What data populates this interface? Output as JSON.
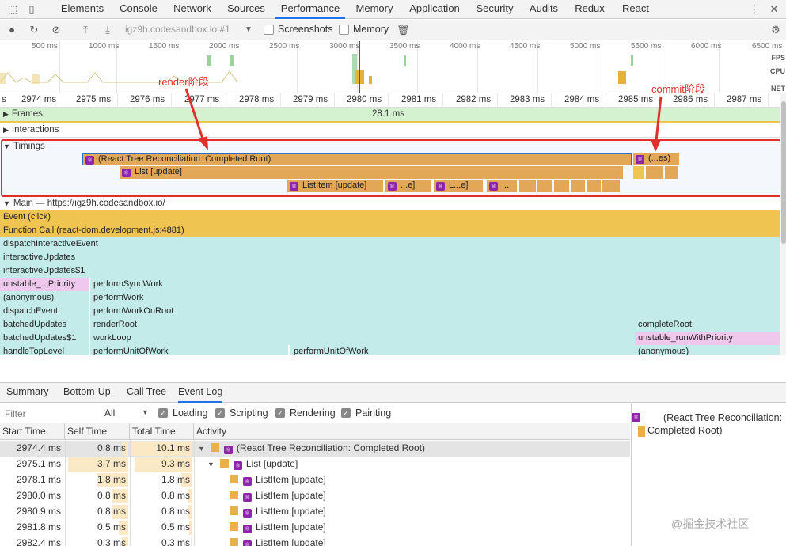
{
  "devtools": {
    "tabs": [
      "Elements",
      "Console",
      "Network",
      "Sources",
      "Performance",
      "Memory",
      "Application",
      "Security",
      "Audits",
      "Redux",
      "React"
    ],
    "active_tab": "Performance"
  },
  "controls": {
    "url_select": "igz9h.codesandbox.io #1",
    "screenshots_label": "Screenshots",
    "memory_label": "Memory"
  },
  "overview": {
    "ticks": [
      "500 ms",
      "1000 ms",
      "1500 ms",
      "2000 ms",
      "2500 ms",
      "3000 ms",
      "3500 ms",
      "4000 ms",
      "4500 ms",
      "5000 ms",
      "5500 ms",
      "6000 ms",
      "6500 ms"
    ],
    "side_labels": [
      "FPS",
      "CPU",
      "NET"
    ]
  },
  "ruler": {
    "ticks": [
      "s",
      "2974 ms",
      "2975 ms",
      "2976 ms",
      "2977 ms",
      "2978 ms",
      "2979 ms",
      "2980 ms",
      "2981 ms",
      "2982 ms",
      "2983 ms",
      "2984 ms",
      "2985 ms",
      "2986 ms",
      "2987 ms"
    ]
  },
  "tracks": {
    "frames_label": "Frames",
    "frames_value": "28.1 ms",
    "interactions_label": "Interactions",
    "timings_label": "Timings",
    "main_label": "Main — https://igz9h.codesandbox.io/"
  },
  "timings": {
    "root": "(React Tree Reconciliation: Completed Root)",
    "commit": "(...es)",
    "list": "List [update]",
    "listitem": "ListItem [update]",
    "small1": "...e]",
    "small2": "L...e]",
    "small3": "..."
  },
  "annotations": {
    "render": "render阶段",
    "commit": "commit阶段"
  },
  "flame": {
    "full_rows": [
      "Event (click)",
      "Function Call (react-dom.development.js:4881)",
      "dispatchInteractiveEvent",
      "interactiveUpdates",
      "interactiveUpdates$1"
    ],
    "left_col": [
      "unstable_...Priority",
      "(anonymous)",
      "dispatchEvent",
      "batchedUpdates",
      "batchedUpdates$1",
      "handleTopLevel"
    ],
    "mid_col": [
      "performSyncWork",
      "performWork",
      "performWorkOnRoot",
      "renderRoot",
      "workLoop",
      "performUnitOfWork"
    ],
    "mid2": "performUnitOfWork",
    "right_col": [
      "completeRoot",
      "unstable_runWithPriority",
      "(anonymous)"
    ]
  },
  "bottom": {
    "tabs": [
      "Summary",
      "Bottom-Up",
      "Call Tree",
      "Event Log"
    ],
    "active_tab": "Event Log",
    "filter_placeholder": "Filter",
    "all_select": "All",
    "checkboxes": [
      "Loading",
      "Scripting",
      "Rendering",
      "Painting"
    ],
    "columns": [
      "Start Time",
      "Self Time",
      "Total Time",
      "Activity"
    ],
    "rows": [
      {
        "start": "2974.4 ms",
        "self": "0.8 ms",
        "self_frac": 0.1,
        "total": "10.1 ms",
        "total_frac": 1.0,
        "activity": "(React Tree Reconciliation: Completed Root)"
      },
      {
        "start": "2975.1 ms",
        "self": "3.7 ms",
        "self_frac": 0.95,
        "total": "9.3 ms",
        "total_frac": 0.92,
        "activity": "List [update]"
      },
      {
        "start": "2978.1 ms",
        "self": "1.8 ms",
        "self_frac": 0.5,
        "total": "1.8 ms",
        "total_frac": 0.18,
        "activity": "ListItem [update]"
      },
      {
        "start": "2980.0 ms",
        "self": "0.8 ms",
        "self_frac": 0.25,
        "total": "0.8 ms",
        "total_frac": 0.08,
        "activity": "ListItem [update]"
      },
      {
        "start": "2980.9 ms",
        "self": "0.8 ms",
        "self_frac": 0.25,
        "total": "0.8 ms",
        "total_frac": 0.08,
        "activity": "ListItem [update]"
      },
      {
        "start": "2981.8 ms",
        "self": "0.5 ms",
        "self_frac": 0.15,
        "total": "0.5 ms",
        "total_frac": 0.05,
        "activity": "ListItem [update]"
      },
      {
        "start": "2982.4 ms",
        "self": "0.3 ms",
        "self_frac": 0.1,
        "total": "0.3 ms",
        "total_frac": 0.03,
        "activity": "ListItem [update]"
      }
    ],
    "details_title": "(React Tree Reconciliation: Completed Root)"
  },
  "watermark": "@掘金技术社区",
  "colors": {
    "timing_bar": "#e3a857",
    "teal": "#c2ebea",
    "yellow": "#f0c451",
    "pink": "#f0c8ee",
    "annotation": "#e0302b"
  }
}
